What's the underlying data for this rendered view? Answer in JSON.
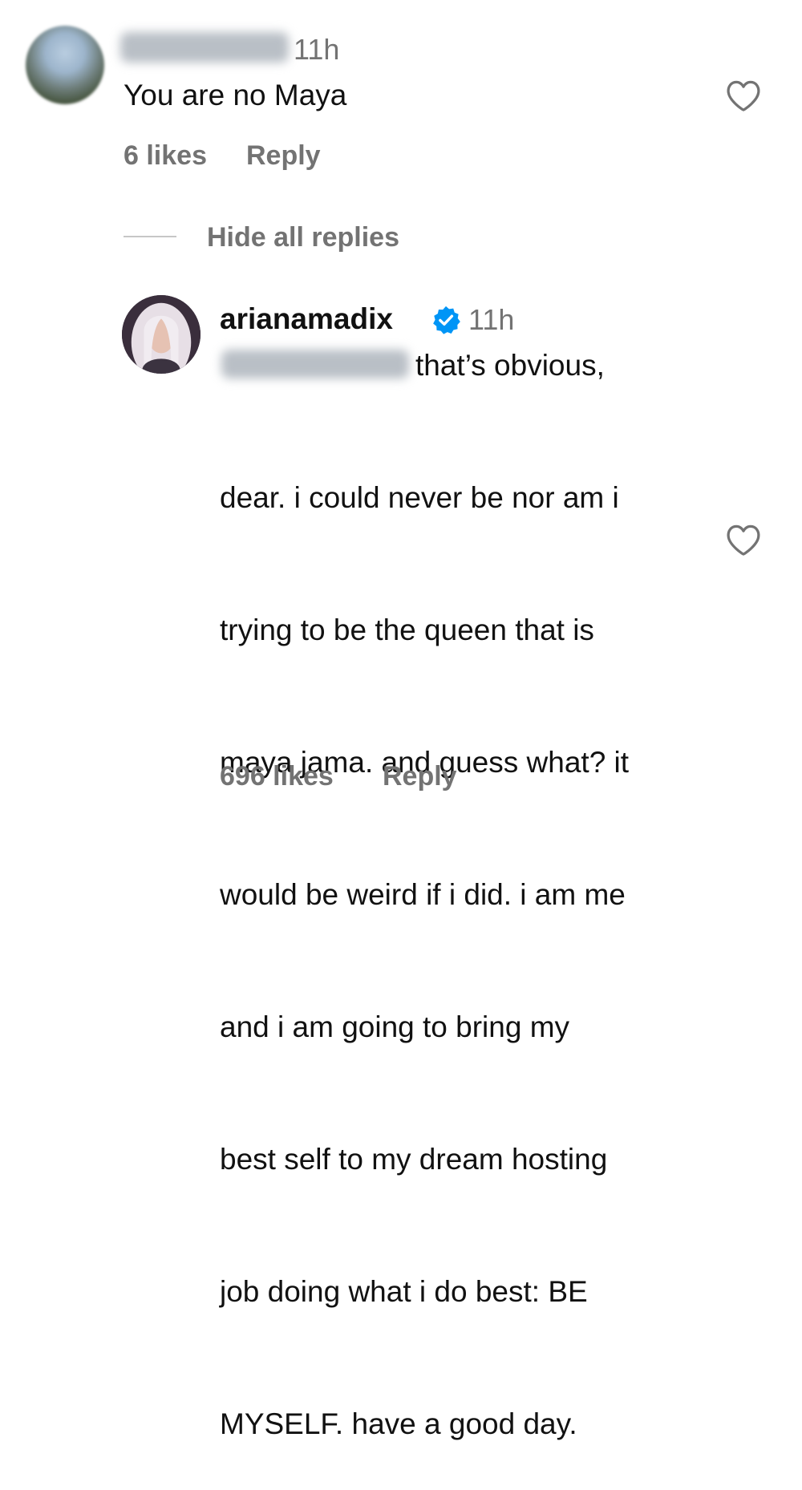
{
  "comment": {
    "time": "11h",
    "text": "You are no Maya",
    "likes": "6 likes",
    "reply_label": "Reply"
  },
  "replies_toggle": {
    "label": "Hide all replies"
  },
  "reply": {
    "username": "arianamadix",
    "verified_icon": "verified-badge",
    "time": "11h",
    "text_first_line": "that’s obvious,",
    "text_lines": [
      "dear. i could never be nor am i",
      "trying to be the queen that is",
      "maya jama. and guess what? it",
      "would be weird if i did. i am me",
      "and i am going to bring my",
      "best self to my dream hosting",
      "job doing what i do best: BE",
      "MYSELF. have a good day."
    ],
    "likes": "696 likes",
    "reply_label": "Reply"
  },
  "icons": {
    "like": "heart-icon",
    "verified": "verified-badge-icon"
  },
  "colors": {
    "text_primary": "#111111",
    "text_secondary": "#737373",
    "verified_blue": "#0095f6",
    "background": "#ffffff"
  }
}
